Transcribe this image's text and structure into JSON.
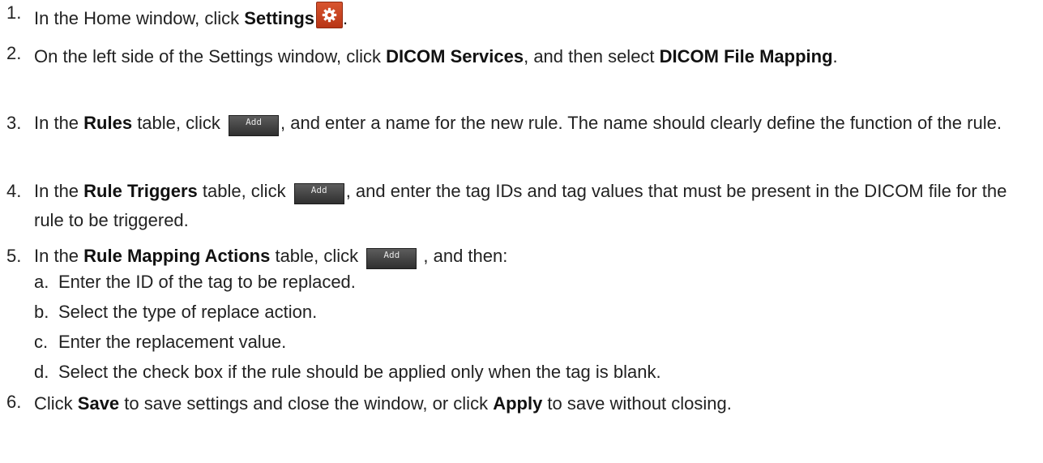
{
  "steps": {
    "s1": {
      "num": "1.",
      "pre": "In the Home window, click ",
      "b1": "Settings",
      "post": "."
    },
    "s2": {
      "num": "2.",
      "pre": "On the left side of the Settings window, click ",
      "b1": "DICOM Services",
      "mid": ", and then select ",
      "b2": "DICOM File Mapping",
      "post": "."
    },
    "s3": {
      "num": "3.",
      "pre": "In the ",
      "b1": "Rules",
      "mid": " table, click ",
      "post": ", and enter a name for the new rule. The name should clearly define the function of the rule."
    },
    "s4": {
      "num": "4.",
      "pre": "In the ",
      "b1": "Rule Triggers",
      "mid": " table, click ",
      "post": ", and enter the tag IDs and tag values that must be present in the DICOM file for the rule to be triggered."
    },
    "s5": {
      "num": "5.",
      "pre": "In the ",
      "b1": "Rule Mapping Actions",
      "mid": " table, click ",
      "post": " , and then:",
      "subs": [
        {
          "letter": "a.",
          "text": "Enter the ID of the tag to be replaced."
        },
        {
          "letter": "b.",
          "text": "Select the type of replace action."
        },
        {
          "letter": "c.",
          "text": "Enter the replacement value."
        },
        {
          "letter": "d.",
          "text": "Select the check box if the rule should be applied only when the tag is blank."
        }
      ]
    },
    "s6": {
      "num": "6.",
      "pre": "Click ",
      "b1": "Save",
      "mid": " to save settings and close the window, or click ",
      "b2": "Apply",
      "post": " to save without closing."
    }
  },
  "add_button_label": "Add",
  "icons": {
    "settings": "gear-icon"
  },
  "colors": {
    "settings_icon_bg": "#c8441f",
    "add_button_bg": "#3f3f3f"
  }
}
